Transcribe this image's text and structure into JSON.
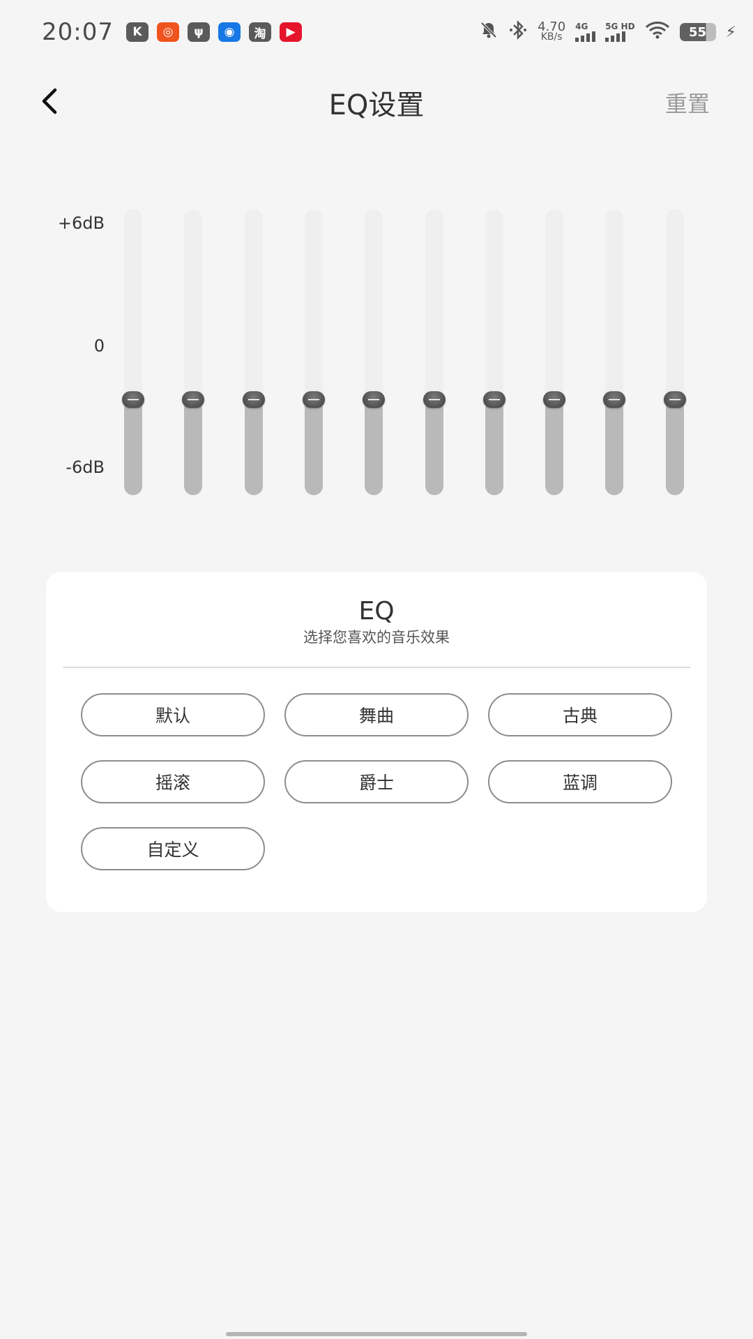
{
  "status_bar": {
    "time": "20:07",
    "app_icons": [
      {
        "name": "kuwo-app-icon",
        "glyph": "K",
        "color": "#5a5a5a"
      },
      {
        "name": "kuaishou-app-icon",
        "glyph": "◎",
        "color": "#f0541e"
      },
      {
        "name": "usb-debug-icon",
        "glyph": "ψ",
        "color": "#5a5a5a"
      },
      {
        "name": "bot-app-icon",
        "glyph": "◉",
        "color": "#1677e5"
      },
      {
        "name": "taobao-app-icon",
        "glyph": "淘",
        "color": "#5a5a5a"
      },
      {
        "name": "video-app-icon",
        "glyph": "▶",
        "color": "#e5152b"
      }
    ],
    "net_speed": "4.70",
    "net_speed_unit": "KB/s",
    "sim1_label": "4G",
    "sim2_label": "5G HD",
    "battery_level": "55"
  },
  "header": {
    "title": "EQ设置",
    "reset_label": "重置"
  },
  "eq": {
    "labels": {
      "top": "+6dB",
      "mid": "0",
      "bottom": "-6dB"
    },
    "range_db": [
      -6,
      6
    ],
    "bands_db": [
      -2,
      -2,
      -2,
      -2,
      -2,
      -2,
      -2,
      -2,
      -2,
      -2
    ]
  },
  "card": {
    "title": "EQ",
    "subtitle": "选择您喜欢的音乐效果",
    "presets": [
      "默认",
      "舞曲",
      "古典",
      "摇滚",
      "爵士",
      "蓝调",
      "自定义"
    ]
  }
}
